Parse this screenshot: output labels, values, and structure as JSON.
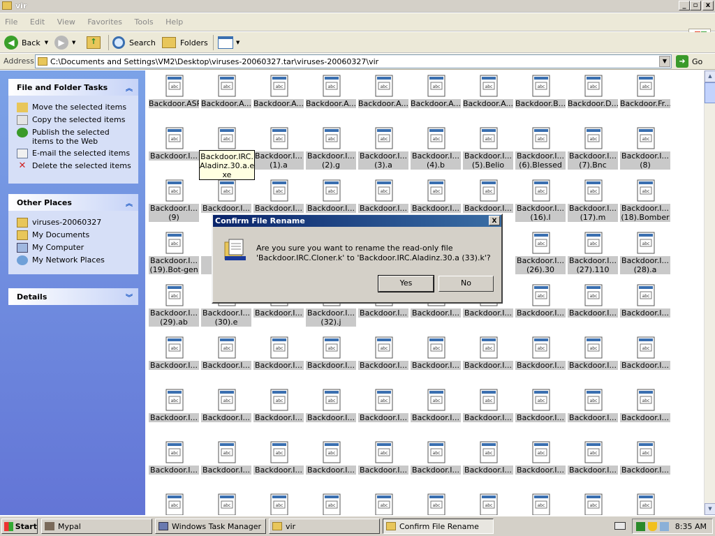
{
  "window": {
    "title": "vir"
  },
  "menu": [
    "File",
    "Edit",
    "View",
    "Favorites",
    "Tools",
    "Help"
  ],
  "toolbar": {
    "back": "Back",
    "search": "Search",
    "folders": "Folders"
  },
  "address": {
    "label": "Address",
    "path": "C:\\Documents and Settings\\VM2\\Desktop\\viruses-20060327.tar\\viruses-20060327\\vir",
    "go": "Go"
  },
  "tasks": {
    "title": "File and Folder Tasks",
    "items": [
      "Move the selected items",
      "Copy the selected items",
      "Publish the selected items to the Web",
      "E-mail the selected items",
      "Delete the selected items"
    ]
  },
  "other_places": {
    "title": "Other Places",
    "items": [
      "viruses-20060327",
      "My Documents",
      "My Computer",
      "My Network Places"
    ]
  },
  "details": {
    "title": "Details"
  },
  "files": [
    [
      "Backdoor.ASP",
      "Backdoor.A...",
      "Backdoor.A...",
      "Backdoor.A...",
      "Backdoor.A...",
      "Backdoor.A...",
      "Backdoor.A...",
      "Backdoor.B...",
      "Backdoor.D...",
      "Backdoor.Fr..."
    ],
    [
      "Backdoor.I...",
      "",
      "Backdoor.I...\n(1).a",
      "Backdoor.I...\n(2).g",
      "Backdoor.I...\n(3).a",
      "Backdoor.I...\n(4).b",
      "Backdoor.I...\n(5).Belio",
      "Backdoor.I...\n(6).Blessed",
      "Backdoor.I...\n(7).Bnc",
      "Backdoor.I...\n(8)"
    ],
    [
      "Backdoor.I...\n(9)",
      "Backdoor.I...",
      "Backdoor.I...",
      "Backdoor.I...",
      "Backdoor.I...",
      "Backdoor.I...",
      "Backdoor.I...",
      "Backdoor.I...\n(16).l",
      "Backdoor.I...\n(17).m",
      "Backdoor.I...\n(18).Bomber"
    ],
    [
      "Backdoor.I...\n(19).Bot-gen",
      "Ba...\n(2...",
      "",
      "",
      "",
      "",
      "",
      "Backdoor.I...\n(26).30",
      "Backdoor.I...\n(27).110",
      "Backdoor.I...\n(28).a"
    ],
    [
      "Backdoor.I...\n(29).ab",
      "Backdoor.I...\n(30).e",
      "Backdoor.I...",
      "Backdoor.I...\n(32).j",
      "Backdoor.I...",
      "Backdoor.I...",
      "Backdoor.I...",
      "Backdoor.I...",
      "Backdoor.I...",
      "Backdoor.I..."
    ],
    [
      "Backdoor.I...",
      "Backdoor.I...",
      "Backdoor.I...",
      "Backdoor.I...",
      "Backdoor.I...",
      "Backdoor.I...",
      "Backdoor.I...",
      "Backdoor.I...",
      "Backdoor.I...",
      "Backdoor.I..."
    ],
    [
      "Backdoor.I...",
      "Backdoor.I...",
      "Backdoor.I...",
      "Backdoor.I...",
      "Backdoor.I...",
      "Backdoor.I...",
      "Backdoor.I...",
      "Backdoor.I...",
      "Backdoor.I...",
      "Backdoor.I..."
    ],
    [
      "Backdoor.I...",
      "Backdoor.I...",
      "Backdoor.I...",
      "Backdoor.I...",
      "Backdoor.I...",
      "Backdoor.I...",
      "Backdoor.I...",
      "Backdoor.I...",
      "Backdoor.I...",
      "Backdoor.I..."
    ],
    [
      "",
      "",
      "",
      "",
      "",
      "",
      "",
      "",
      "",
      ""
    ]
  ],
  "tooltip": "Backdoor.IRC.\nAladinz.30.a.e\nxe",
  "dialog": {
    "title": "Confirm File Rename",
    "message_line1": "Are you sure you want to rename the read-only file",
    "message_line2": "'Backdoor.IRC.Cloner.k' to 'Backdoor.IRC.Aladinz.30.a (33).k'?",
    "yes": "Yes",
    "no": "No",
    "close": "X"
  },
  "taskbar": {
    "start": "Start",
    "tasks": [
      "Mypal",
      "Windows Task Manager",
      "vir",
      "Confirm File Rename"
    ],
    "clock": "8:35 AM"
  }
}
